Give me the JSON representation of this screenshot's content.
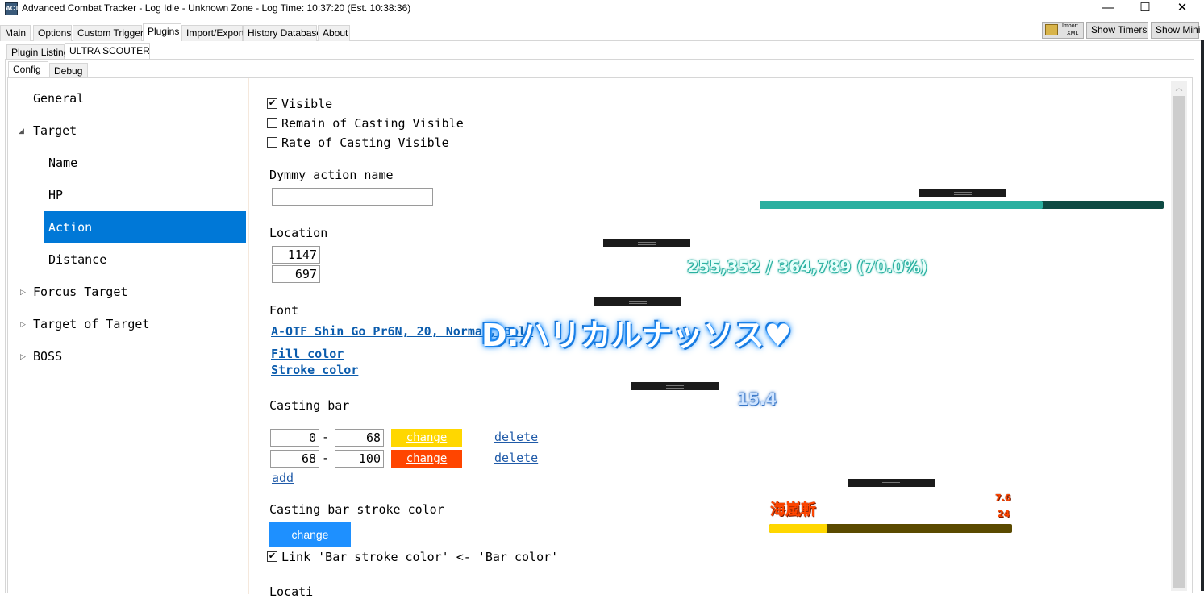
{
  "window": {
    "icon_text": "ACT",
    "title": "Advanced Combat Tracker - Log Idle - Unknown Zone - Log Time: 10:37:20 (Est. 10:38:36)",
    "minimize": "—",
    "maximize": "☐",
    "close": "✕"
  },
  "menu_tabs": [
    "Main",
    "Options",
    "Custom Triggers",
    "Plugins",
    "Import/Export",
    "History Database",
    "About"
  ],
  "toolbar": {
    "import_xml_line1": "Import",
    "import_xml_line2": "XML",
    "show_timers": "Show Timers",
    "show_mini": "Show Mini"
  },
  "plugin_tabs": [
    "Plugin Listing",
    "ULTRA SCOUTER"
  ],
  "config_tabs": [
    "Config",
    "Debug"
  ],
  "tree": {
    "general": "General",
    "target": "Target",
    "name": "Name",
    "hp": "HP",
    "action": "Action",
    "distance": "Distance",
    "focus_target": "Forcus Target",
    "target_of_target": "Target of Target",
    "boss": "BOSS"
  },
  "config": {
    "visible_label": "Visible",
    "visible_checked": true,
    "remain_casting_label": "Remain of Casting Visible",
    "remain_casting_checked": false,
    "rate_casting_label": "Rate of Casting Visible",
    "rate_casting_checked": false,
    "dummy_action_label": "Dymmy action name",
    "dummy_action_value": "",
    "location_label": "Location",
    "location_x": "1147",
    "location_y": "697",
    "font_label": "Font",
    "font_value": "A-OTF Shin Go Pr6N, 20, Normal, Bold",
    "fill_color_link": "Fill color",
    "stroke_color_link": "Stroke color",
    "casting_bar_label": "Casting bar",
    "casting_bar_rows": [
      {
        "from": "0",
        "to": "68",
        "button": "change",
        "color": "#ffd700",
        "delete": "delete"
      },
      {
        "from": "68",
        "to": "100",
        "button": "change",
        "color": "#ff4500",
        "delete": "delete"
      }
    ],
    "add_link": "add",
    "stroke_color_label": "Casting bar stroke color",
    "stroke_color_button": "change",
    "stroke_color_button_color": "#1e90ff",
    "link_bar_label": "Link 'Bar stroke color' <- 'Bar color'",
    "link_bar_checked": true,
    "cutoff_label": "Locati"
  },
  "overlay": {
    "hp_bar_fill": 0.7,
    "hp_bar_color": "#2ab0a0",
    "hp_bar_bg": "#0e4a43",
    "hp_text": "255,352 / 364,789 (70.0%)",
    "target_name": "D:ハリカルナッソス♥",
    "distance_value": "15.4",
    "action_name": "海嵐斬",
    "action_time": "7.6",
    "action_rate": "24",
    "action_bar_fill": 0.24,
    "action_bar_color": "#ffd700",
    "action_bar_bg": "#5a4a00",
    "action_text_color": "#ff4500"
  }
}
